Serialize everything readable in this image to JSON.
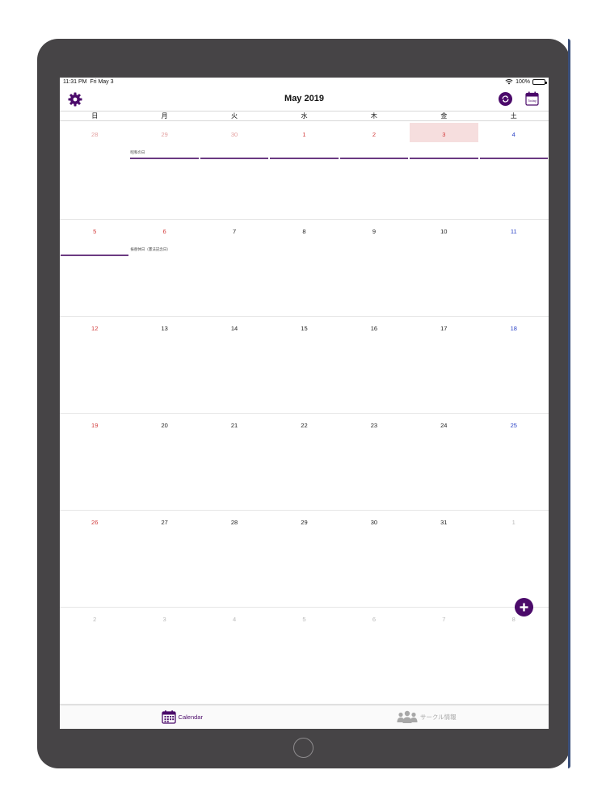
{
  "status_bar": {
    "time": "11:31 PM",
    "date": "Fri May 3",
    "battery": "100%"
  },
  "nav": {
    "title": "May 2019",
    "today_label": "Today"
  },
  "colors": {
    "accent": "#4b0a6a",
    "holiday": "#d23b3b",
    "saturday": "#2b42c6",
    "today_bg": "#f6dede",
    "event_bar": "#6b3a82"
  },
  "weekdays": [
    "日",
    "月",
    "火",
    "水",
    "木",
    "金",
    "土"
  ],
  "weeks": [
    [
      {
        "label": "28",
        "kind": "muted-red"
      },
      {
        "label": "29",
        "kind": "muted-red",
        "event": "昭和の日"
      },
      {
        "label": "30",
        "kind": "muted-red",
        "event": ""
      },
      {
        "label": "1",
        "kind": "holiday",
        "event": ""
      },
      {
        "label": "2",
        "kind": "holiday",
        "event": ""
      },
      {
        "label": "3",
        "kind": "holiday",
        "today": true,
        "event": ""
      },
      {
        "label": "4",
        "kind": "saturday",
        "event": ""
      }
    ],
    [
      {
        "label": "5",
        "kind": "holiday",
        "event": ""
      },
      {
        "label": "6",
        "kind": "holiday",
        "event_text": "振替休日（憲法記念日）"
      },
      {
        "label": "7",
        "kind": "normal"
      },
      {
        "label": "8",
        "kind": "normal"
      },
      {
        "label": "9",
        "kind": "normal"
      },
      {
        "label": "10",
        "kind": "normal"
      },
      {
        "label": "11",
        "kind": "saturday"
      }
    ],
    [
      {
        "label": "12",
        "kind": "holiday"
      },
      {
        "label": "13",
        "kind": "normal"
      },
      {
        "label": "14",
        "kind": "normal"
      },
      {
        "label": "15",
        "kind": "normal"
      },
      {
        "label": "16",
        "kind": "normal"
      },
      {
        "label": "17",
        "kind": "normal"
      },
      {
        "label": "18",
        "kind": "saturday"
      }
    ],
    [
      {
        "label": "19",
        "kind": "holiday"
      },
      {
        "label": "20",
        "kind": "normal"
      },
      {
        "label": "21",
        "kind": "normal"
      },
      {
        "label": "22",
        "kind": "normal"
      },
      {
        "label": "23",
        "kind": "normal"
      },
      {
        "label": "24",
        "kind": "normal"
      },
      {
        "label": "25",
        "kind": "saturday"
      }
    ],
    [
      {
        "label": "26",
        "kind": "holiday"
      },
      {
        "label": "27",
        "kind": "normal"
      },
      {
        "label": "28",
        "kind": "normal"
      },
      {
        "label": "29",
        "kind": "normal"
      },
      {
        "label": "30",
        "kind": "normal"
      },
      {
        "label": "31",
        "kind": "normal"
      },
      {
        "label": "1",
        "kind": "muted"
      }
    ],
    [
      {
        "label": "2",
        "kind": "muted"
      },
      {
        "label": "3",
        "kind": "muted"
      },
      {
        "label": "4",
        "kind": "muted"
      },
      {
        "label": "5",
        "kind": "muted"
      },
      {
        "label": "6",
        "kind": "muted"
      },
      {
        "label": "7",
        "kind": "muted"
      },
      {
        "label": "8",
        "kind": "muted"
      }
    ]
  ],
  "tabs": [
    {
      "label": "Calendar",
      "icon": "calendar-icon",
      "active": true
    },
    {
      "label": "サークル情報",
      "icon": "group-icon",
      "active": false
    }
  ]
}
